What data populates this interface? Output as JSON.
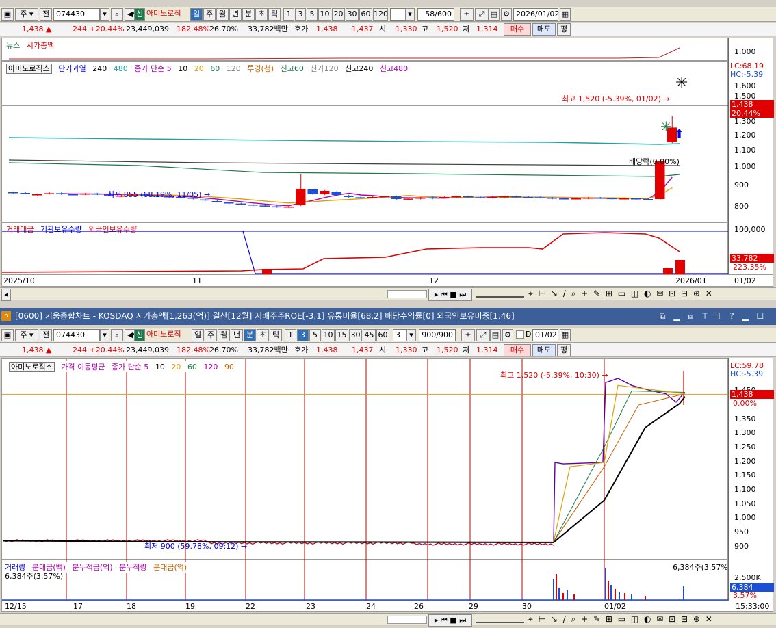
{
  "top_window": {
    "toolbar": {
      "market": "주",
      "prev_button": "전",
      "code": "074430",
      "badge": "신",
      "name": "아미노로직",
      "periods": [
        "일",
        "주",
        "월",
        "년",
        "분",
        "초",
        "틱"
      ],
      "selected_period": "일",
      "nums": [
        "1",
        "3",
        "5",
        "10",
        "20",
        "30",
        "60",
        "120"
      ],
      "count": "58/600",
      "date": "2026/01/02"
    },
    "info": {
      "price": "1,438 ▲",
      "change": "244 +20.44%",
      "volume": "23,449,039",
      "vol_ratio": "182.48%",
      "turnover": "26.70%",
      "amount": "33,782백만",
      "hoga_label": "호가",
      "ask": "1,438",
      "bid": "1,437",
      "open_label": "시",
      "open": "1,330",
      "high_label": "고",
      "high": "1,520",
      "low_label": "저",
      "low": "1,314",
      "buy": "매수",
      "sell": "매도",
      "eval": "평"
    },
    "news_legend": [
      "뉴스",
      "시가총액"
    ],
    "news_axis": "1,000",
    "price_legend": {
      "name": "아미노로직스",
      "items": [
        "단기과열",
        "240",
        "480",
        "종가 단순 5",
        "10",
        "20",
        "60",
        "120",
        "투경(청)",
        "신고60",
        "신가120",
        "신고240",
        "신고480"
      ]
    },
    "price_axis": [
      "1,600",
      "1,500",
      "1,400",
      "1,300",
      "1,200",
      "1,100",
      "1,000",
      "900",
      "800"
    ],
    "lc": "LC:68.19",
    "hc": "HC:-5.39",
    "last_tag": "1,438",
    "pct_tag": "20.44%",
    "high_annotation": "최고 1,520 (-5.39%, 01/02) →",
    "low_annotation": "최저 855 (68.19%, 11/05) →",
    "dividend_annotation": "배당락(0.00%)",
    "vol_legend": [
      "거래대금",
      "기관보유수량",
      "외국인보유수량"
    ],
    "vol_axis": "100,000",
    "vol_tag": "33,782",
    "vol_pct": "223.35%",
    "x_labels": [
      "2025/10",
      "11",
      "12",
      "2026/01"
    ],
    "x_right": "01/02"
  },
  "bottom_window": {
    "title": "[0600] 키움종합차트 - KOSDAQ 시가총액[1,263(억)] 결산[12월] 지배주주ROE[-3.1] 유통비율[68.2] 배당수익률[0] 외국인보유비중[1.46]",
    "toolbar": {
      "market": "주",
      "prev_button": "전",
      "code": "074430",
      "badge": "신",
      "name": "아미노로직",
      "periods": [
        "일",
        "주",
        "월",
        "년",
        "분",
        "초",
        "틱"
      ],
      "selected_period": "분",
      "nums": [
        "1",
        "3",
        "5",
        "10",
        "15",
        "30",
        "45",
        "60"
      ],
      "selected_num": "3",
      "interval": "3",
      "count": "900/900",
      "date": "01/02"
    },
    "info": {
      "price": "1,438 ▲",
      "change": "244 +20.44%",
      "volume": "23,449,039",
      "vol_ratio": "182.48%",
      "turnover": "26.70%",
      "amount": "33,782백만",
      "hoga_label": "호가",
      "ask": "1,438",
      "bid": "1,437",
      "open_label": "시",
      "open": "1,330",
      "high_label": "고",
      "high": "1,520",
      "low_label": "저",
      "low": "1,314",
      "buy": "매수",
      "sell": "매도",
      "eval": "평"
    },
    "price_legend": {
      "name": "아미노로직스",
      "items": [
        "가격 이동평균",
        "종가 단순 5",
        "10",
        "20",
        "60",
        "120",
        "90"
      ]
    },
    "price_axis": [
      "1,450",
      "1,400",
      "1,350",
      "1,300",
      "1,250",
      "1,200",
      "1,150",
      "1,100",
      "1,050",
      "1,000",
      "950",
      "900"
    ],
    "lc": "LC:59.78",
    "hc": "HC:-5.39",
    "last_tag": "1,438",
    "pct_tag": "0.00%",
    "high_annotation": "최고 1,520 (-5.39%, 10:30) →",
    "low_annotation": "최저 900 (59.78%, 09:12) →",
    "vol_legend": [
      "거래량",
      "분대금(백)",
      "분누적금(억)",
      "분누적량",
      "분대금(억)"
    ],
    "vol_left": "6,384주(3.57%)",
    "vol_right": "6,384주(3.57%)",
    "vol_axis": "2,500K",
    "vol_tag": "6,384",
    "vol_pct": "3.57%",
    "x_labels": [
      "12/15",
      "17",
      "18",
      "19",
      "22",
      "23",
      "24",
      "26",
      "29",
      "30",
      "01/02"
    ],
    "x_right": "15:33:00"
  },
  "colors": {
    "up": "#e00000",
    "down": "#1a4fd6",
    "accent": "#2f6fb7",
    "titlebar": "#3d5f99"
  }
}
